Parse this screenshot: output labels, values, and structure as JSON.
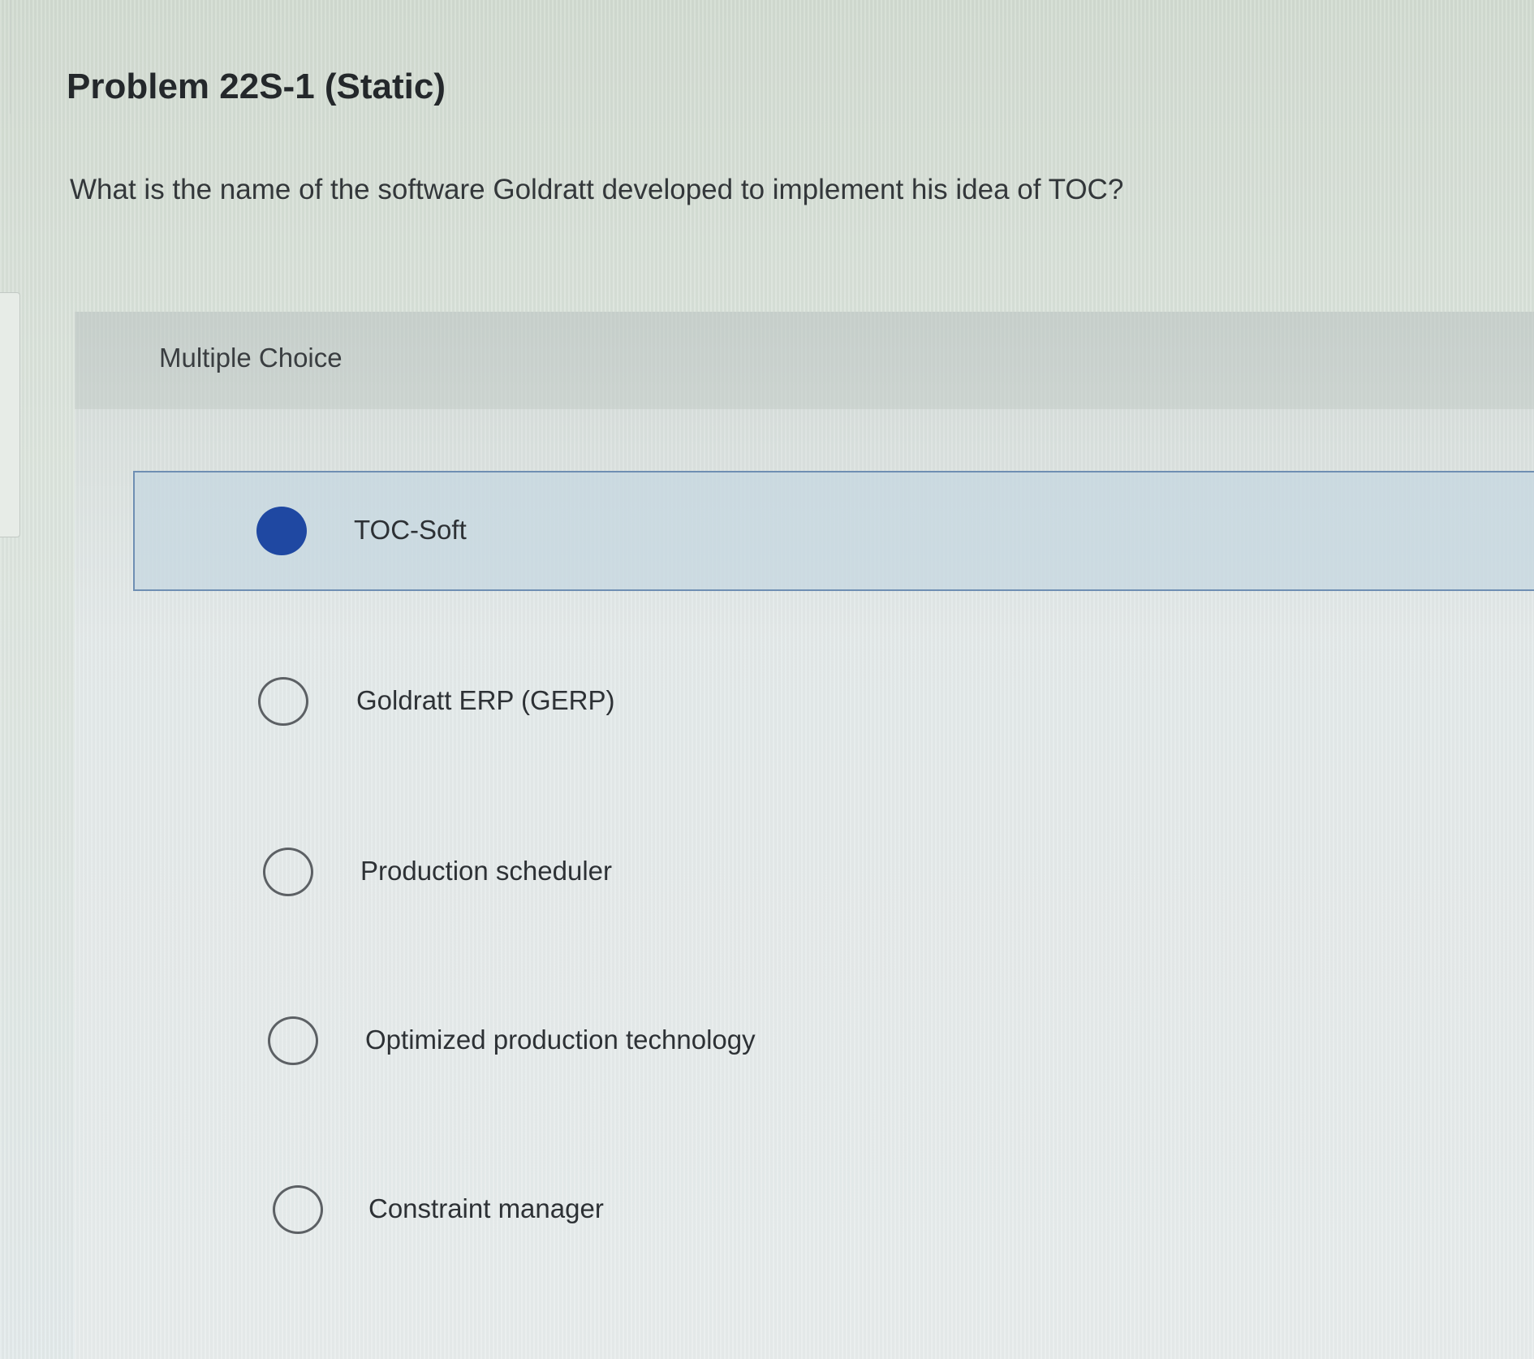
{
  "problem": {
    "title": "Problem 22S-1 (Static)",
    "question": "What is the name of the software Goldratt developed to implement his idea of TOC?"
  },
  "multiple_choice": {
    "label": "Multiple Choice",
    "selected_index": 0,
    "selected_color": "#1f48a2",
    "options": [
      {
        "label": "TOC-Soft",
        "selected": true
      },
      {
        "label": "Goldratt ERP (GERP)",
        "selected": false
      },
      {
        "label": "Production scheduler",
        "selected": false
      },
      {
        "label": "Optimized production technology",
        "selected": false
      },
      {
        "label": "Constraint manager",
        "selected": false
      }
    ]
  }
}
